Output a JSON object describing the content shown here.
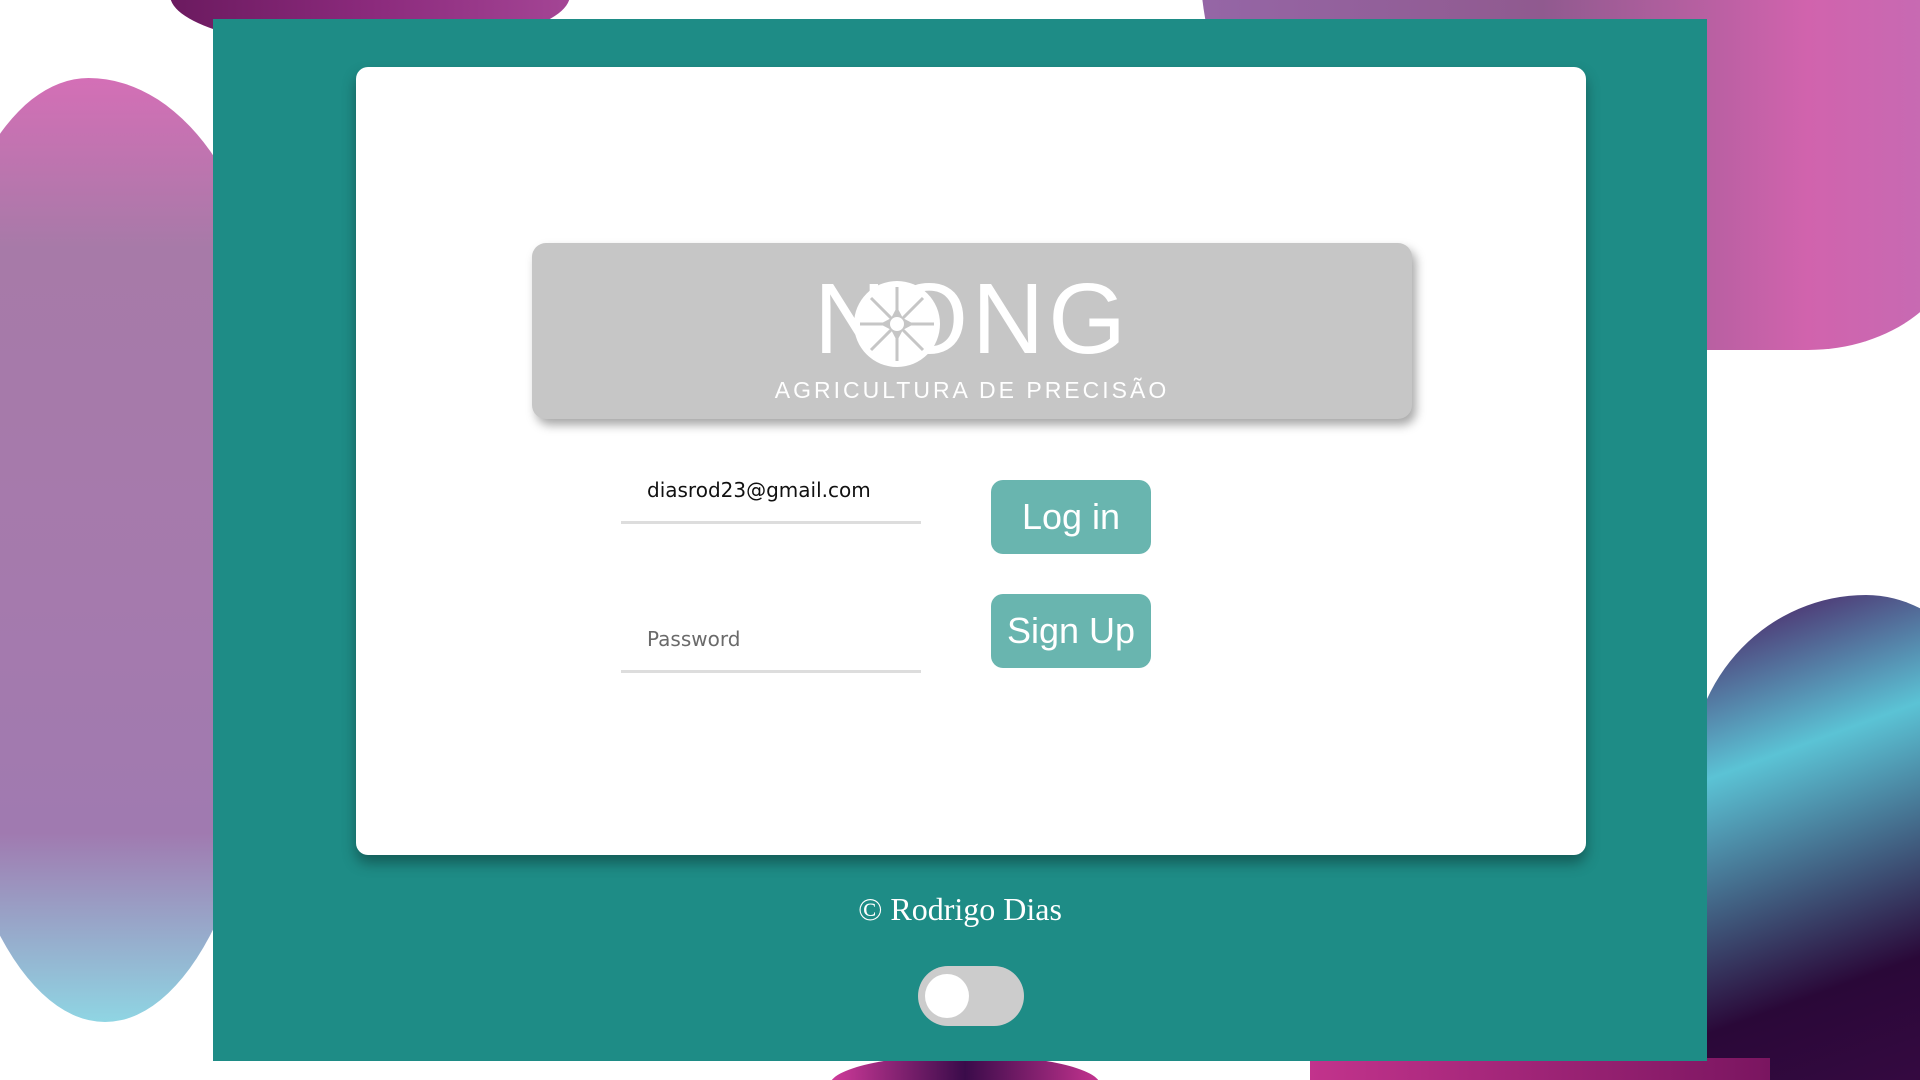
{
  "login": {
    "logo_word": "NONG",
    "logo_subtitle": "AGRICULTURA DE PRECISÃO",
    "email_value": "diasrod23@gmail.com",
    "password_placeholder": "Password",
    "login_label": "Log in",
    "signup_label": "Sign Up"
  },
  "footer": {
    "copyright": "© Rodrigo Dias",
    "theme_toggle_on": false
  },
  "colors": {
    "frame": "#1e8c86",
    "button": "#69b5af",
    "logo_box": "#c6c6c6"
  },
  "icons": [
    "compass-emblem-icon",
    "toggle-knob-icon"
  ]
}
